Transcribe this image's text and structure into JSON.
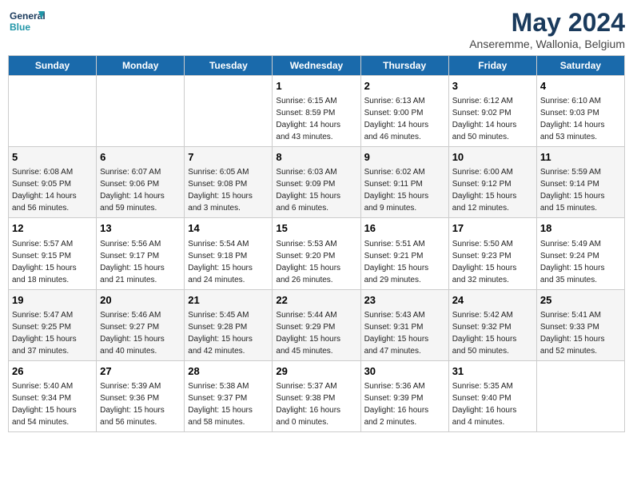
{
  "logo": {
    "line1": "General",
    "line2": "Blue"
  },
  "title": "May 2024",
  "subtitle": "Anseremme, Wallonia, Belgium",
  "weekdays": [
    "Sunday",
    "Monday",
    "Tuesday",
    "Wednesday",
    "Thursday",
    "Friday",
    "Saturday"
  ],
  "weeks": [
    [
      {
        "day": "",
        "info": ""
      },
      {
        "day": "",
        "info": ""
      },
      {
        "day": "",
        "info": ""
      },
      {
        "day": "1",
        "info": "Sunrise: 6:15 AM\nSunset: 8:59 PM\nDaylight: 14 hours\nand 43 minutes."
      },
      {
        "day": "2",
        "info": "Sunrise: 6:13 AM\nSunset: 9:00 PM\nDaylight: 14 hours\nand 46 minutes."
      },
      {
        "day": "3",
        "info": "Sunrise: 6:12 AM\nSunset: 9:02 PM\nDaylight: 14 hours\nand 50 minutes."
      },
      {
        "day": "4",
        "info": "Sunrise: 6:10 AM\nSunset: 9:03 PM\nDaylight: 14 hours\nand 53 minutes."
      }
    ],
    [
      {
        "day": "5",
        "info": "Sunrise: 6:08 AM\nSunset: 9:05 PM\nDaylight: 14 hours\nand 56 minutes."
      },
      {
        "day": "6",
        "info": "Sunrise: 6:07 AM\nSunset: 9:06 PM\nDaylight: 14 hours\nand 59 minutes."
      },
      {
        "day": "7",
        "info": "Sunrise: 6:05 AM\nSunset: 9:08 PM\nDaylight: 15 hours\nand 3 minutes."
      },
      {
        "day": "8",
        "info": "Sunrise: 6:03 AM\nSunset: 9:09 PM\nDaylight: 15 hours\nand 6 minutes."
      },
      {
        "day": "9",
        "info": "Sunrise: 6:02 AM\nSunset: 9:11 PM\nDaylight: 15 hours\nand 9 minutes."
      },
      {
        "day": "10",
        "info": "Sunrise: 6:00 AM\nSunset: 9:12 PM\nDaylight: 15 hours\nand 12 minutes."
      },
      {
        "day": "11",
        "info": "Sunrise: 5:59 AM\nSunset: 9:14 PM\nDaylight: 15 hours\nand 15 minutes."
      }
    ],
    [
      {
        "day": "12",
        "info": "Sunrise: 5:57 AM\nSunset: 9:15 PM\nDaylight: 15 hours\nand 18 minutes."
      },
      {
        "day": "13",
        "info": "Sunrise: 5:56 AM\nSunset: 9:17 PM\nDaylight: 15 hours\nand 21 minutes."
      },
      {
        "day": "14",
        "info": "Sunrise: 5:54 AM\nSunset: 9:18 PM\nDaylight: 15 hours\nand 24 minutes."
      },
      {
        "day": "15",
        "info": "Sunrise: 5:53 AM\nSunset: 9:20 PM\nDaylight: 15 hours\nand 26 minutes."
      },
      {
        "day": "16",
        "info": "Sunrise: 5:51 AM\nSunset: 9:21 PM\nDaylight: 15 hours\nand 29 minutes."
      },
      {
        "day": "17",
        "info": "Sunrise: 5:50 AM\nSunset: 9:23 PM\nDaylight: 15 hours\nand 32 minutes."
      },
      {
        "day": "18",
        "info": "Sunrise: 5:49 AM\nSunset: 9:24 PM\nDaylight: 15 hours\nand 35 minutes."
      }
    ],
    [
      {
        "day": "19",
        "info": "Sunrise: 5:47 AM\nSunset: 9:25 PM\nDaylight: 15 hours\nand 37 minutes."
      },
      {
        "day": "20",
        "info": "Sunrise: 5:46 AM\nSunset: 9:27 PM\nDaylight: 15 hours\nand 40 minutes."
      },
      {
        "day": "21",
        "info": "Sunrise: 5:45 AM\nSunset: 9:28 PM\nDaylight: 15 hours\nand 42 minutes."
      },
      {
        "day": "22",
        "info": "Sunrise: 5:44 AM\nSunset: 9:29 PM\nDaylight: 15 hours\nand 45 minutes."
      },
      {
        "day": "23",
        "info": "Sunrise: 5:43 AM\nSunset: 9:31 PM\nDaylight: 15 hours\nand 47 minutes."
      },
      {
        "day": "24",
        "info": "Sunrise: 5:42 AM\nSunset: 9:32 PM\nDaylight: 15 hours\nand 50 minutes."
      },
      {
        "day": "25",
        "info": "Sunrise: 5:41 AM\nSunset: 9:33 PM\nDaylight: 15 hours\nand 52 minutes."
      }
    ],
    [
      {
        "day": "26",
        "info": "Sunrise: 5:40 AM\nSunset: 9:34 PM\nDaylight: 15 hours\nand 54 minutes."
      },
      {
        "day": "27",
        "info": "Sunrise: 5:39 AM\nSunset: 9:36 PM\nDaylight: 15 hours\nand 56 minutes."
      },
      {
        "day": "28",
        "info": "Sunrise: 5:38 AM\nSunset: 9:37 PM\nDaylight: 15 hours\nand 58 minutes."
      },
      {
        "day": "29",
        "info": "Sunrise: 5:37 AM\nSunset: 9:38 PM\nDaylight: 16 hours\nand 0 minutes."
      },
      {
        "day": "30",
        "info": "Sunrise: 5:36 AM\nSunset: 9:39 PM\nDaylight: 16 hours\nand 2 minutes."
      },
      {
        "day": "31",
        "info": "Sunrise: 5:35 AM\nSunset: 9:40 PM\nDaylight: 16 hours\nand 4 minutes."
      },
      {
        "day": "",
        "info": ""
      }
    ]
  ]
}
